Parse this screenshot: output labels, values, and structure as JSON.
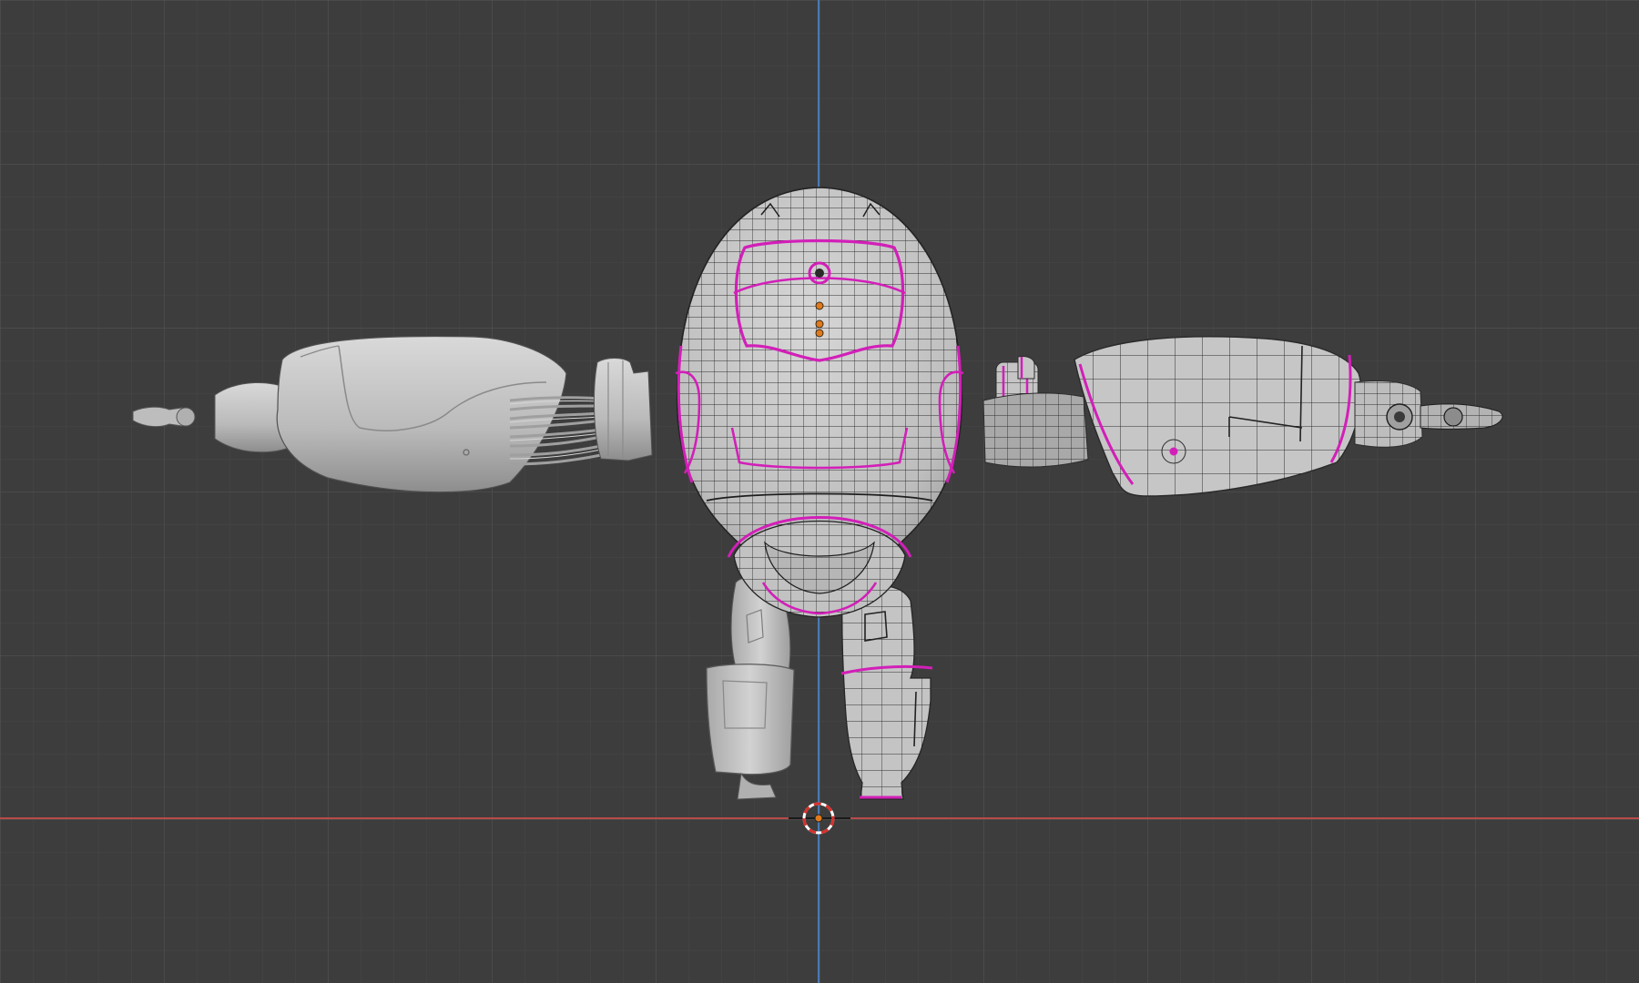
{
  "app": {
    "view": "3d-viewport",
    "projection": "front-orthographic",
    "shading": "solid",
    "overlays": "wireframe-with-marked-seams"
  },
  "colors": {
    "background": "#3d3d3d",
    "grid_minor": "#444444",
    "grid_major": "#4f4f4f",
    "axis_x": "#b84a4a",
    "axis_z": "#4a79b4",
    "mesh_fill": "#c7c7c7",
    "mesh_shade": "#a9a9a9",
    "mesh_outline": "#2a2a2a",
    "wire": "#2f2f2f",
    "seam": "#d21fb8",
    "cursor_red": "#d9302b",
    "cursor_white": "#ffffff"
  },
  "scene": {
    "object_name": "robot",
    "parts": [
      {
        "name": "head-body",
        "wireframe": true
      },
      {
        "name": "left-arm",
        "wireframe": false
      },
      {
        "name": "right-arm",
        "wireframe": true
      },
      {
        "name": "left-leg",
        "wireframe": false
      },
      {
        "name": "right-leg",
        "wireframe": true
      }
    ],
    "icons": [
      "3d-cursor-icon",
      "origin-point-icon"
    ]
  }
}
